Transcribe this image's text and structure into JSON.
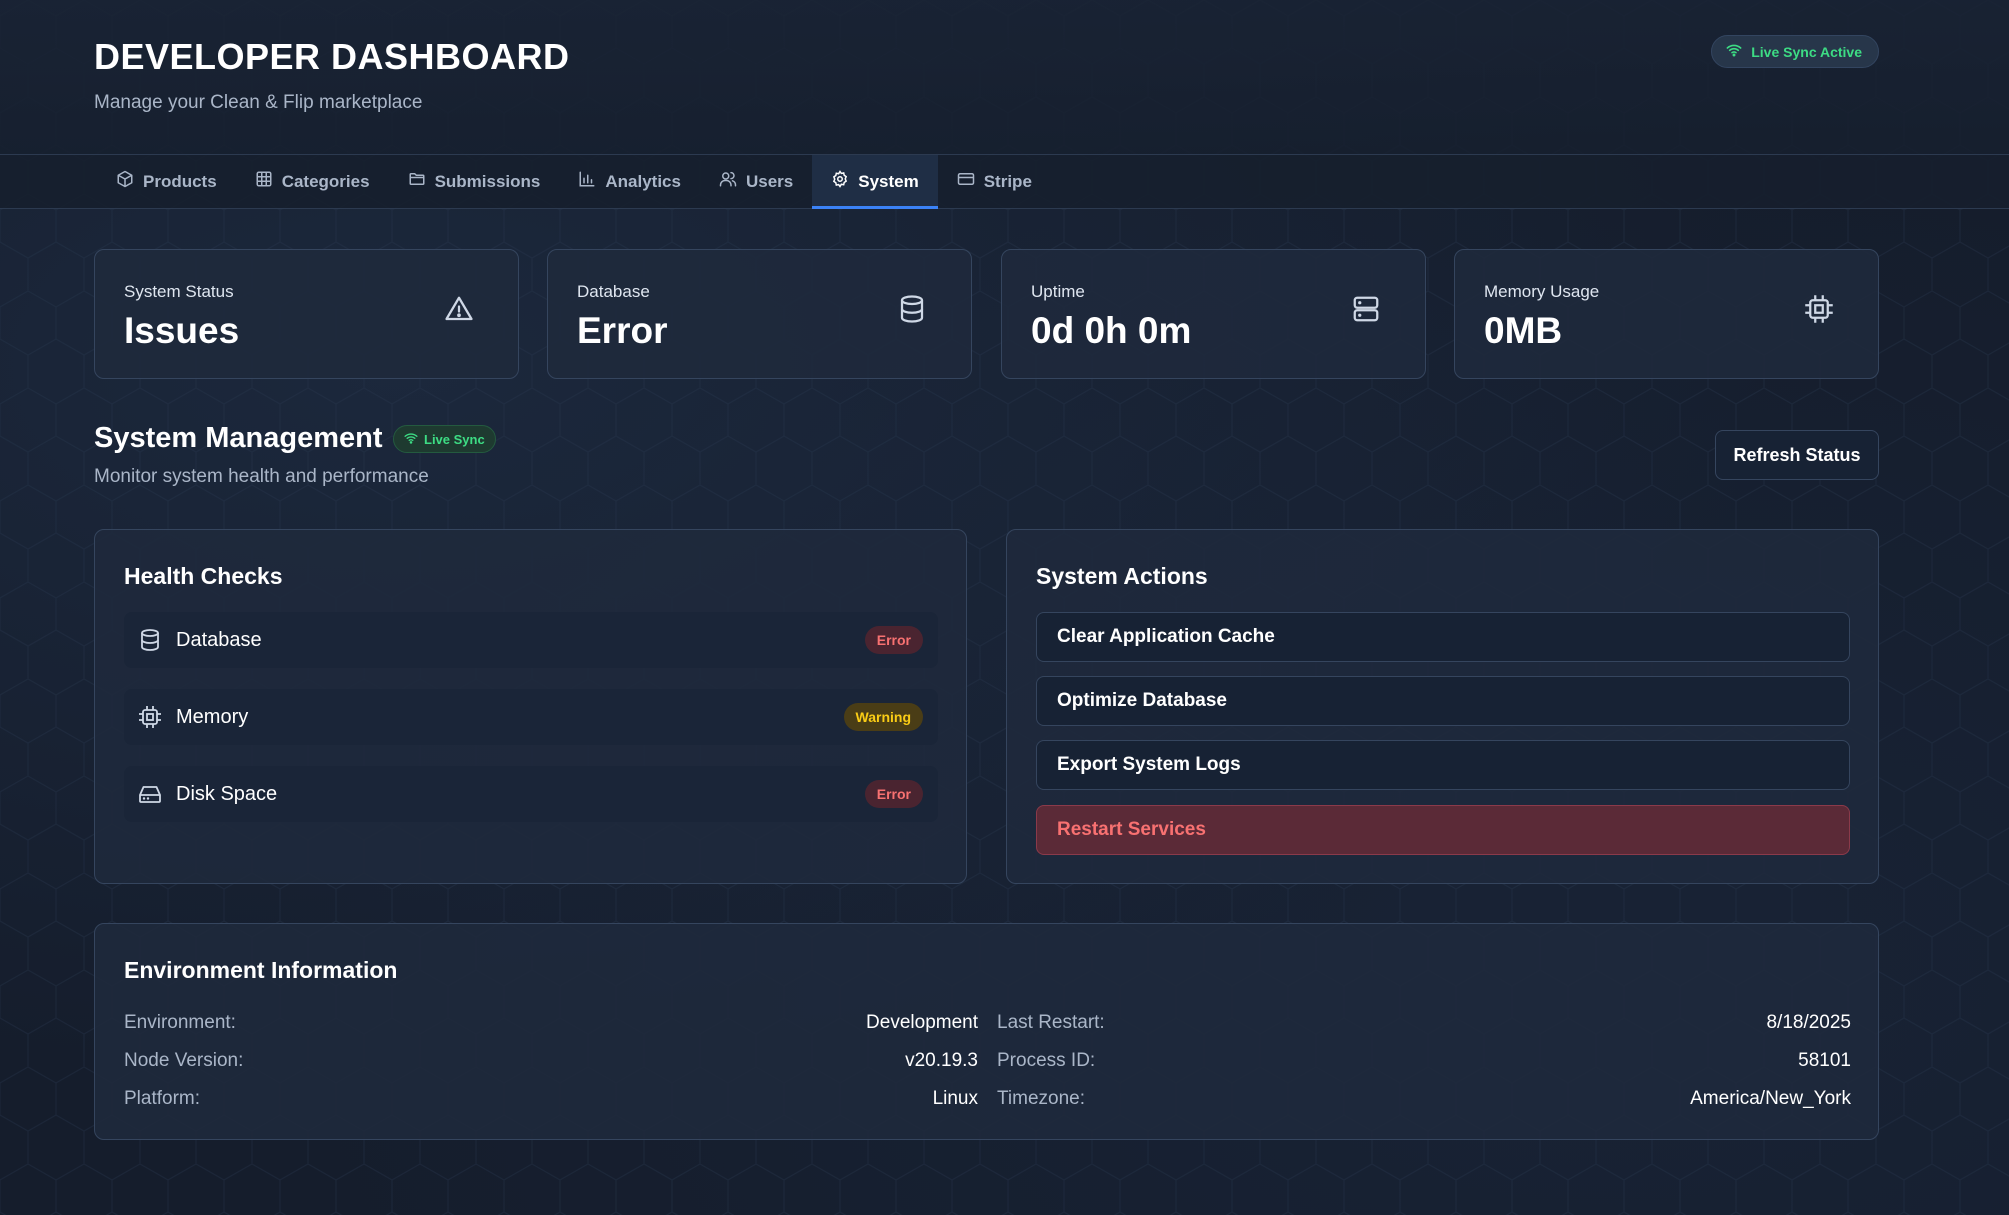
{
  "header": {
    "title": "DEVELOPER DASHBOARD",
    "subtitle": "Manage your Clean & Flip marketplace",
    "live_status": "Live Sync Active"
  },
  "tabs": [
    {
      "label": "Products",
      "icon": "box-icon"
    },
    {
      "label": "Categories",
      "icon": "grid-icon"
    },
    {
      "label": "Submissions",
      "icon": "folder-icon"
    },
    {
      "label": "Analytics",
      "icon": "bar-chart-icon"
    },
    {
      "label": "Users",
      "icon": "users-icon"
    },
    {
      "label": "System",
      "icon": "gear-icon",
      "active": true
    },
    {
      "label": "Stripe",
      "icon": "credit-card-icon"
    }
  ],
  "stats": [
    {
      "label": "System Status",
      "value": "Issues",
      "icon": "warning-triangle-icon"
    },
    {
      "label": "Database",
      "value": "Error",
      "icon": "database-icon"
    },
    {
      "label": "Uptime",
      "value": "0d 0h 0m",
      "icon": "server-icon"
    },
    {
      "label": "Memory Usage",
      "value": "0MB",
      "icon": "cpu-icon"
    }
  ],
  "section": {
    "title": "System Management",
    "badge": "Live Sync",
    "subtitle": "Monitor system health and performance",
    "refresh_label": "Refresh Status"
  },
  "health": {
    "title": "Health Checks",
    "items": [
      {
        "label": "Database",
        "status": "Error",
        "icon": "database-icon"
      },
      {
        "label": "Memory",
        "status": "Warning",
        "icon": "cpu-icon"
      },
      {
        "label": "Disk Space",
        "status": "Error",
        "icon": "hard-drive-icon"
      }
    ]
  },
  "actions": {
    "title": "System Actions",
    "items": [
      {
        "label": "Clear Application Cache"
      },
      {
        "label": "Optimize Database"
      },
      {
        "label": "Export System Logs"
      },
      {
        "label": "Restart Services"
      }
    ]
  },
  "environment": {
    "title": "Environment Information",
    "left": [
      {
        "key": "Environment:",
        "value": "Development"
      },
      {
        "key": "Node Version:",
        "value": "v20.19.3"
      },
      {
        "key": "Platform:",
        "value": "Linux"
      }
    ],
    "right": [
      {
        "key": "Last Restart:",
        "value": "8/18/2025"
      },
      {
        "key": "Process ID:",
        "value": "58101"
      },
      {
        "key": "Timezone:",
        "value": "America/New_York"
      }
    ]
  },
  "colors": {
    "background": "#151d2c",
    "card": "#1e293c",
    "accent": "#3b82f6",
    "success": "#3ddc84",
    "error": "#f87171",
    "warning": "#facc15"
  }
}
